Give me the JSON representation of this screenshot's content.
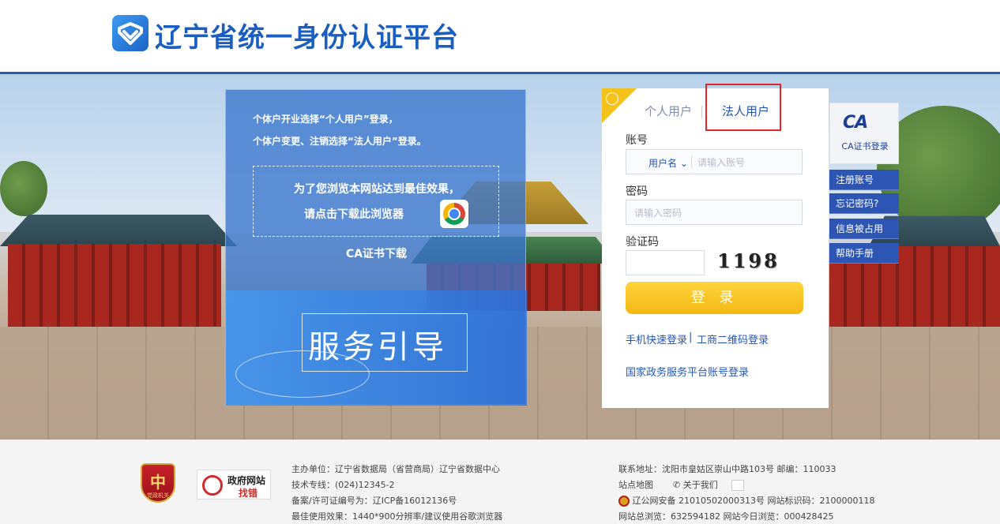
{
  "header": {
    "title": "辽宁省统一身份认证平台"
  },
  "guide": {
    "tip1": "个体户开业选择“个人用户”登录，",
    "tip2": "个体户变更、注销选择“法人用户”登录。",
    "best_effect": "为了您浏览本网站达到最佳效果，",
    "download_browser": "请点击下载此浏览器",
    "ca_download": "CA证书下载",
    "service_guide": "服务引导"
  },
  "login": {
    "tabs": [
      "个人用户",
      "法人用户"
    ],
    "account_label": "账号",
    "account_type": "用户名",
    "account_placeholder": "请输入账号",
    "password_label": "密码",
    "password_placeholder": "请输入密码",
    "captcha_label": "验证码",
    "captcha_text": "1198",
    "submit": "登 录",
    "link_mobile": "手机快速登录",
    "link_separator": "|",
    "link_qr": "工商二维码登录",
    "link_national": "国家政务服务平台账号登录"
  },
  "side": {
    "ca_login": "CA证书登录",
    "buttons": [
      "注册账号",
      "忘记密码?",
      "信息被占用",
      "帮助手册"
    ]
  },
  "footer": {
    "party_badge": "党政机关",
    "gov_badge_line1": "政府网站",
    "gov_badge_line2": "找错",
    "left": [
      "主办单位：辽宁省数据局（省营商局）辽宁省数据中心",
      "技术专线：(024)12345-2",
      "备案/许可证编号为：辽ICP备16012136号",
      "最佳使用效果：1440*900分辨率/建议使用谷歌浏览器"
    ],
    "address": "联系地址：沈阳市皇姑区崇山中路103号   邮编：110033",
    "sitemap": "站点地图",
    "about": "关于我们",
    "security": "辽公网安备 21010502000313号 网站标识码：2100000118",
    "stats": "网站总浏览：632594182    网站今日浏览：000428425"
  }
}
